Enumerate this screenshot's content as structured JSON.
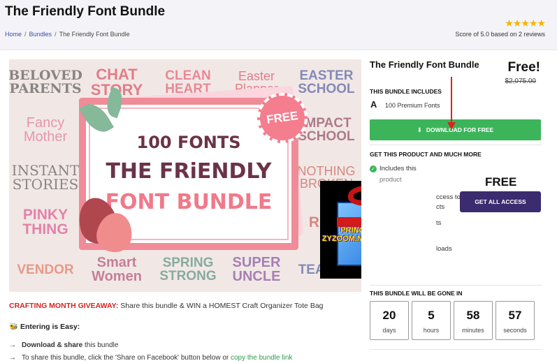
{
  "header": {
    "title": "The Friendly Font Bundle",
    "breadcrumb": [
      "Home",
      "Bundles",
      "The Friendly Font Bundle"
    ],
    "rating_stars": "★★★★★",
    "rating": 5,
    "score_text": "Score of 5.0 based on 2 reviews"
  },
  "hero": {
    "tiles": [
      "BELOVED PARENTS",
      "CHAT STORY",
      "CLEAN HEART",
      "Easter Planner",
      "EASTER SCHOOL",
      "Fancy Mother",
      "IMPACT SCHOOL",
      "INSTANT STORIES",
      "NOTHING BROKEN",
      "PINKY THING",
      "Re M",
      "VENDOR",
      "Smart Women",
      "SPRING STRONG",
      "SUPER UNCLE",
      "TEA FLO"
    ],
    "card_line1": "100 FONTS",
    "card_line2": "THE FRiENDLY",
    "card_line3": "FONT BUNDLE",
    "free_badge": "FREE",
    "gift_text": "PRINCEOFADEN ZYZOOM.NET GIVEAWAYS"
  },
  "promo": {
    "lead": "CRAFTING MONTH GIVEAWAY:",
    "text": " Share this bundle & WIN a HOMEST Craft Organizer Tote Bag",
    "easy": "Entering is Easy:",
    "easy_icon": "🐝",
    "step1_bold": "Download & share",
    "step1_rest": " this bundle",
    "step2_text": "To share this bundle, click the 'Share on Facebook' button below or ",
    "step2_link": "copy the bundle link"
  },
  "product": {
    "title": "The Friendly Font Bundle",
    "price": "Free!",
    "old_price": "$2,075.00",
    "includes_heading": "THIS BUNDLE INCLUDES",
    "includes_icon": "A",
    "includes_text": "100 Premium Fonts",
    "download_label": "DOWNLOAD FOR FREE",
    "more_heading": "GET THIS PRODUCT AND MUCH MORE",
    "more_items": [
      "Includes this",
      "product",
      "ccess to",
      "cts",
      "ts",
      "loads"
    ],
    "free_label": "FREE",
    "access_label": "GET ALL ACCESS",
    "gone_heading": "THIS BUNDLE WILL BE GONE IN",
    "countdown": [
      {
        "value": "20",
        "unit": "days"
      },
      {
        "value": "5",
        "unit": "hours"
      },
      {
        "value": "58",
        "unit": "minutes"
      },
      {
        "value": "57",
        "unit": "seconds"
      }
    ]
  },
  "colors": {
    "accent_green": "#3cb55a",
    "accent_purple": "#3a2c6e",
    "promo_red": "#d6241f",
    "star": "#f6b400"
  }
}
